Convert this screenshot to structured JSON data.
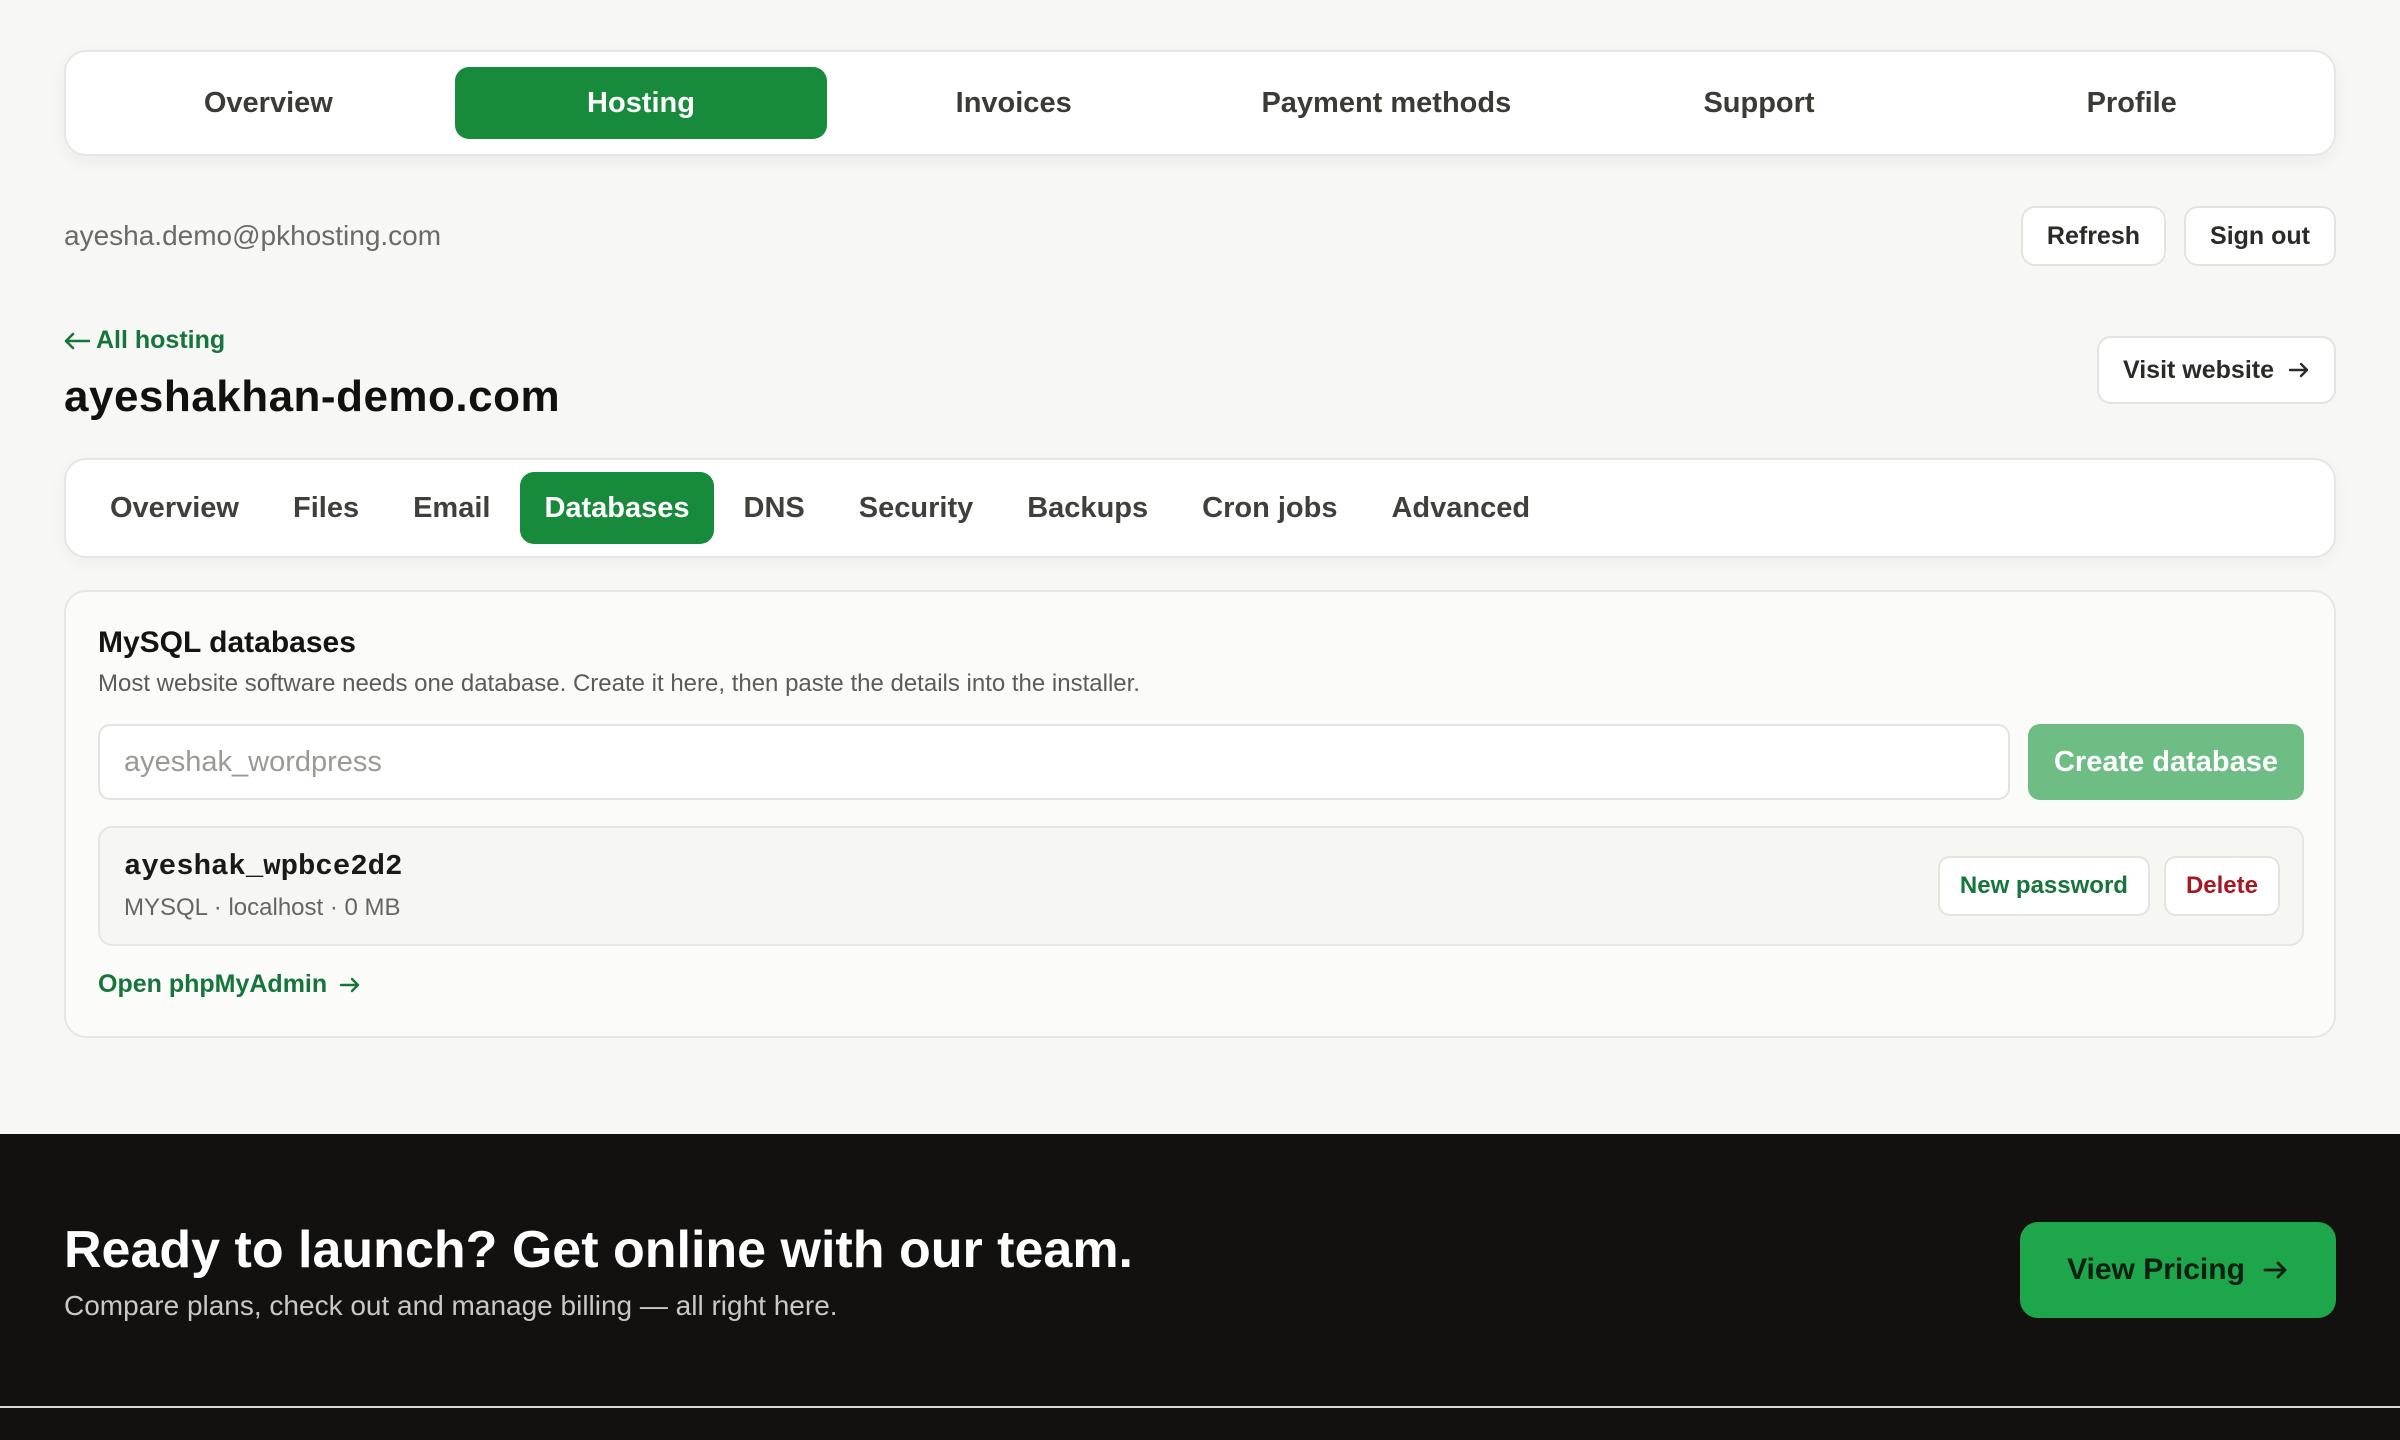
{
  "top_nav": {
    "items": [
      {
        "label": "Overview"
      },
      {
        "label": "Hosting",
        "active": true
      },
      {
        "label": "Invoices"
      },
      {
        "label": "Payment methods"
      },
      {
        "label": "Support"
      },
      {
        "label": "Profile"
      }
    ]
  },
  "account": {
    "email": "ayesha.demo@pkhosting.com",
    "refresh_label": "Refresh",
    "signout_label": "Sign out"
  },
  "site": {
    "back_label": "All hosting",
    "domain": "ayeshakhan-demo.com",
    "visit_label": "Visit website"
  },
  "sub_nav": {
    "items": [
      {
        "label": "Overview"
      },
      {
        "label": "Files"
      },
      {
        "label": "Email"
      },
      {
        "label": "Databases",
        "active": true
      },
      {
        "label": "DNS"
      },
      {
        "label": "Security"
      },
      {
        "label": "Backups"
      },
      {
        "label": "Cron jobs"
      },
      {
        "label": "Advanced"
      }
    ]
  },
  "databases": {
    "title": "MySQL databases",
    "description": "Most website software needs one database. Create it here, then paste the details into the installer.",
    "input_placeholder": "ayeshak_wordpress",
    "create_label": "Create database",
    "items": [
      {
        "name": "ayeshak_wpbce2d2",
        "meta": "MYSQL · localhost · 0 MB",
        "new_password_label": "New password",
        "delete_label": "Delete"
      }
    ],
    "phpmyadmin_label": "Open phpMyAdmin"
  },
  "cta": {
    "title": "Ready to launch? Get online with our team.",
    "subtitle": "Compare plans, check out and manage billing — all right here.",
    "button_label": "View Pricing"
  },
  "colors": {
    "accent": "#178a3c",
    "accent_light": "#6dbd85",
    "danger": "#a51a22",
    "footer_bg": "#121110"
  }
}
